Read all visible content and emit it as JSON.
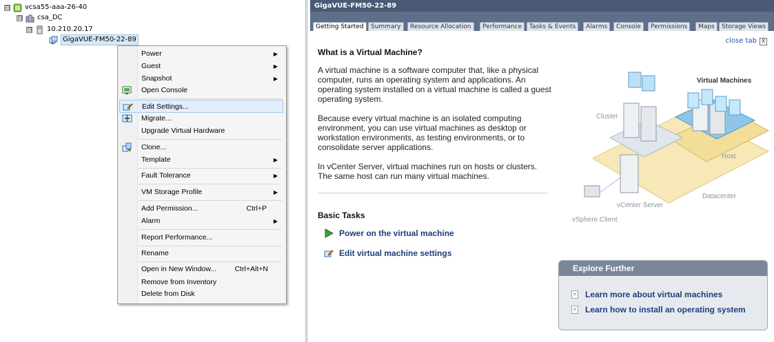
{
  "tree": {
    "nodes": [
      {
        "label": "vcsa55-aaa-26-40",
        "expander": "⊟"
      },
      {
        "label": "csa_DC",
        "expander": "⊟"
      },
      {
        "label": "10.210.20.17",
        "expander": "⊟"
      },
      {
        "label": "GigaVUE-FM50-22-89",
        "expander": ""
      }
    ]
  },
  "context_menu": {
    "items": [
      {
        "label": "Power",
        "submenu": true
      },
      {
        "label": "Guest",
        "submenu": true
      },
      {
        "label": "Snapshot",
        "submenu": true
      },
      {
        "label": "Open Console",
        "icon": "console-icon"
      },
      {
        "label": "Edit Settings...",
        "icon": "edit-settings-icon",
        "highlighted": true
      },
      {
        "label": "Migrate...",
        "icon": "migrate-icon"
      },
      {
        "label": "Upgrade Virtual Hardware"
      },
      {
        "label": "Clone...",
        "icon": "clone-icon"
      },
      {
        "label": "Template",
        "submenu": true
      },
      {
        "label": "Fault Tolerance",
        "submenu": true
      },
      {
        "label": "VM Storage Profile",
        "submenu": true
      },
      {
        "label": "Add Permission...",
        "shortcut": "Ctrl+P"
      },
      {
        "label": "Alarm",
        "submenu": true
      },
      {
        "label": "Report Performance..."
      },
      {
        "label": "Rename"
      },
      {
        "label": "Open in New Window...",
        "shortcut": "Ctrl+Alt+N"
      },
      {
        "label": "Remove from Inventory"
      },
      {
        "label": "Delete from Disk"
      }
    ]
  },
  "panel": {
    "title": "GigaVUE-FM50-22-89",
    "tabs": [
      "Getting Started",
      "Summary",
      "Resource Allocation",
      "Performance",
      "Tasks & Events",
      "Alarms",
      "Console",
      "Permissions",
      "Maps",
      "Storage Views"
    ],
    "active_tab": "Getting Started",
    "close_tab": "close tab",
    "close_x": "X"
  },
  "getting_started": {
    "heading": "What is a Virtual Machine?",
    "paragraphs": [
      "A virtual machine is a software computer that, like a physical computer, runs an operating system and applications. An operating system installed on a virtual machine is called a guest operating system.",
      "Because every virtual machine is an isolated computing environment, you can use virtual machines as desktop or workstation environments, as testing environments, or to consolidate server applications.",
      "In vCenter Server, virtual machines run on hosts or clusters. The same host can run many virtual machines."
    ],
    "basic_tasks_heading": "Basic Tasks",
    "tasks": [
      "Power on the virtual machine",
      "Edit virtual machine settings"
    ],
    "diagram_labels": {
      "virtual_machines": "Virtual Machines",
      "cluster": "Cluster",
      "host": "Host",
      "datacenter": "Datacenter",
      "vcenter_server": "vCenter Server",
      "vsphere_client": "vSphere Client"
    }
  },
  "explore": {
    "heading": "Explore Further",
    "links": [
      "Learn more about virtual machines",
      "Learn how to install an operating system"
    ]
  },
  "colors": {
    "titlebar": "#4a5a74",
    "tabstrip": "#5e6f8a",
    "link": "#1a3f7a",
    "menu_highlight": "#e3eefa"
  }
}
